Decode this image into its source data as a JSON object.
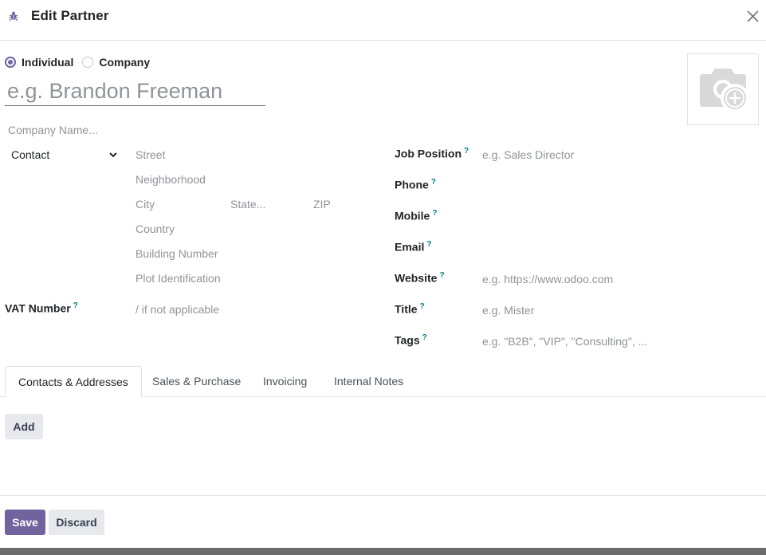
{
  "dialog": {
    "title": "Edit Partner"
  },
  "company_type": {
    "individual_label": "Individual",
    "company_label": "Company",
    "selected": "Individual"
  },
  "name": {
    "placeholder": "e.g. Brandon Freeman"
  },
  "company_name": {
    "placeholder": "Company Name..."
  },
  "address": {
    "type_value": "Contact",
    "street": "Street",
    "neighborhood": "Neighborhood",
    "city": "City",
    "state": "State...",
    "zip": "ZIP",
    "country": "Country",
    "building_number": "Building Number",
    "plot_identification": "Plot Identification"
  },
  "vat": {
    "label": "VAT Number",
    "help": "?",
    "placeholder": "/ if not applicable"
  },
  "right_fields": {
    "job_position": {
      "label": "Job Position",
      "help": "?",
      "placeholder": "e.g. Sales Director"
    },
    "phone": {
      "label": "Phone",
      "help": "?"
    },
    "mobile": {
      "label": "Mobile",
      "help": "?"
    },
    "email": {
      "label": "Email",
      "help": "?"
    },
    "website": {
      "label": "Website",
      "help": "?",
      "placeholder": "e.g. https://www.odoo.com"
    },
    "title": {
      "label": "Title",
      "help": "?",
      "placeholder": "e.g. Mister"
    },
    "tags": {
      "label": "Tags",
      "help": "?",
      "placeholder": "e.g. \"B2B\", \"VIP\", \"Consulting\", ..."
    }
  },
  "tabs": [
    {
      "label": "Contacts & Addresses",
      "active": true
    },
    {
      "label": "Sales & Purchase",
      "active": false
    },
    {
      "label": "Invoicing",
      "active": false
    },
    {
      "label": "Internal Notes",
      "active": false
    }
  ],
  "buttons": {
    "add": "Add",
    "save": "Save",
    "discard": "Discard"
  },
  "icons": {
    "header": "bug-icon",
    "close": "close-icon",
    "photo": "camera-plus-icon",
    "select": "chevron-down-icon"
  },
  "colors": {
    "primary": "#71639e",
    "help": "#017e84",
    "placeholder": "#8f9499"
  }
}
